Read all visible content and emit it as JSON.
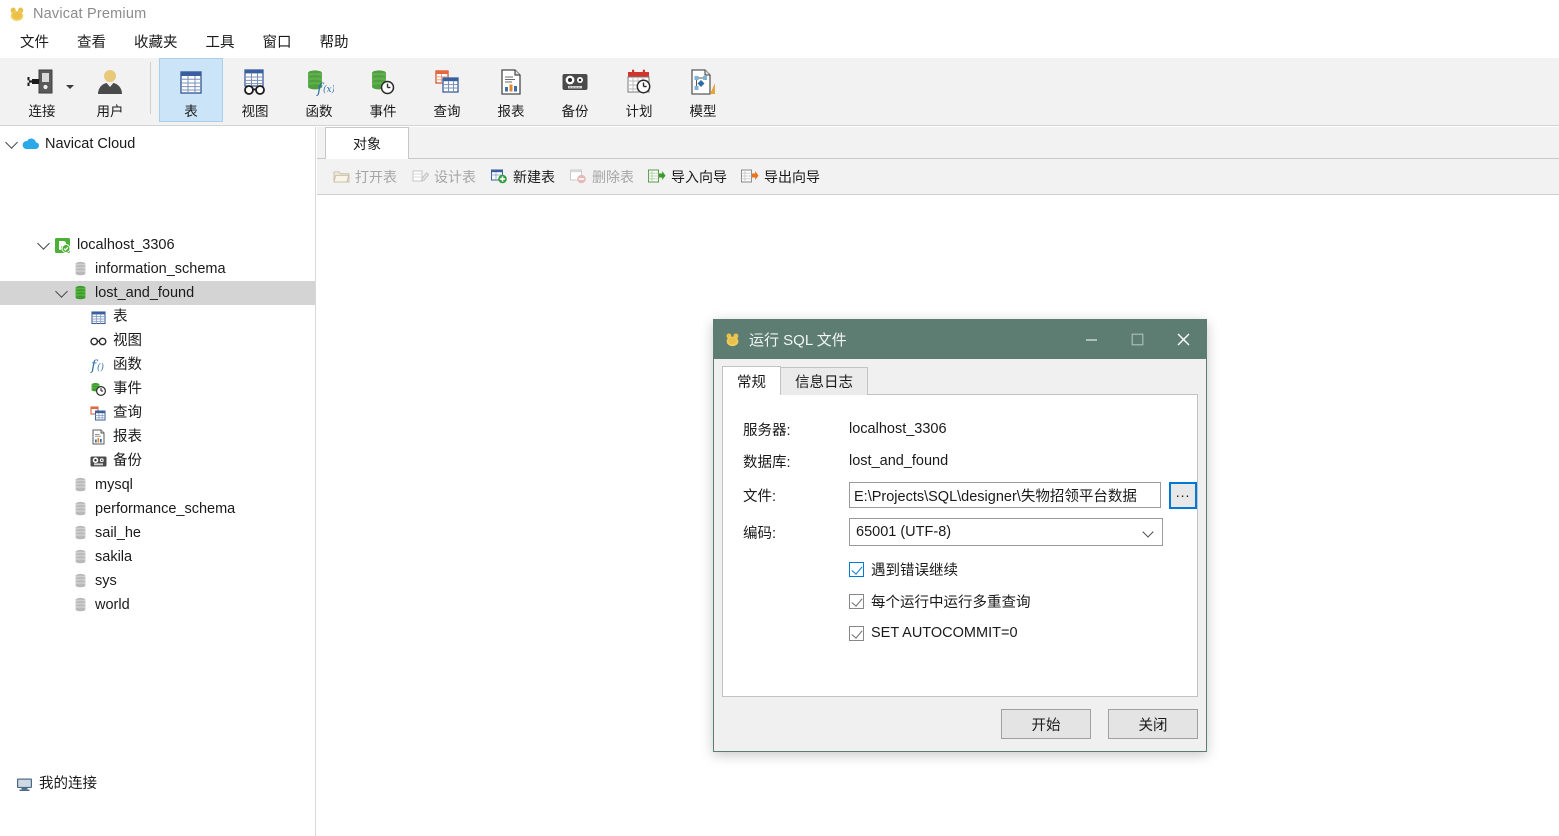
{
  "window": {
    "title": "Navicat Premium",
    "logo_icon": "navicat-logo-icon"
  },
  "menubar": {
    "items": [
      {
        "label": "文件",
        "name": "menu-file"
      },
      {
        "label": "查看",
        "name": "menu-view"
      },
      {
        "label": "收藏夹",
        "name": "menu-favorites"
      },
      {
        "label": "工具",
        "name": "menu-tools"
      },
      {
        "label": "窗口",
        "name": "menu-window"
      },
      {
        "label": "帮助",
        "name": "menu-help"
      }
    ]
  },
  "toolbar": {
    "buttons": [
      {
        "label": "连接",
        "icon": "connection-icon",
        "selected": false,
        "has_caret": true
      },
      {
        "label": "用户",
        "icon": "user-icon",
        "selected": false,
        "has_caret": false
      },
      {
        "label": "表",
        "icon": "table-icon",
        "selected": true,
        "has_caret": false
      },
      {
        "label": "视图",
        "icon": "view-icon",
        "selected": false,
        "has_caret": false
      },
      {
        "label": "函数",
        "icon": "function-icon",
        "selected": false,
        "has_caret": false
      },
      {
        "label": "事件",
        "icon": "event-icon",
        "selected": false,
        "has_caret": false
      },
      {
        "label": "查询",
        "icon": "query-icon",
        "selected": false,
        "has_caret": false
      },
      {
        "label": "报表",
        "icon": "report-icon",
        "selected": false,
        "has_caret": false
      },
      {
        "label": "备份",
        "icon": "backup-icon",
        "selected": false,
        "has_caret": false
      },
      {
        "label": "计划",
        "icon": "schedule-icon",
        "selected": false,
        "has_caret": false
      },
      {
        "label": "模型",
        "icon": "model-icon",
        "selected": false,
        "has_caret": false
      }
    ]
  },
  "sidebar": {
    "cloud": {
      "label": "Navicat Cloud",
      "icon": "cloud-icon"
    },
    "connection": {
      "label": "localhost_3306",
      "icon": "mysql-connection-icon"
    },
    "databases": [
      {
        "label": "information_schema",
        "icon": "database-icon-gray",
        "selected": false,
        "expanded": false
      },
      {
        "label": "lost_and_found",
        "icon": "database-icon-green",
        "selected": true,
        "expanded": true
      },
      {
        "label": "mysql",
        "icon": "database-icon-gray",
        "selected": false,
        "expanded": false
      },
      {
        "label": "performance_schema",
        "icon": "database-icon-gray",
        "selected": false,
        "expanded": false
      },
      {
        "label": "sail_he",
        "icon": "database-icon-gray",
        "selected": false,
        "expanded": false
      },
      {
        "label": "sakila",
        "icon": "database-icon-gray",
        "selected": false,
        "expanded": false
      },
      {
        "label": "sys",
        "icon": "database-icon-gray",
        "selected": false,
        "expanded": false
      },
      {
        "label": "world",
        "icon": "database-icon-gray",
        "selected": false,
        "expanded": false
      }
    ],
    "db_children": [
      {
        "label": "表",
        "icon": "table-icon"
      },
      {
        "label": "视图",
        "icon": "view-icon"
      },
      {
        "label": "函数",
        "icon": "function-icon"
      },
      {
        "label": "事件",
        "icon": "event-icon"
      },
      {
        "label": "查询",
        "icon": "query-icon"
      },
      {
        "label": "报表",
        "icon": "report-icon"
      },
      {
        "label": "备份",
        "icon": "backup-icon"
      }
    ],
    "my_connections": {
      "label": "我的连接",
      "icon": "monitor-icon"
    }
  },
  "objects_panel": {
    "tab_label": "对象",
    "actions": [
      {
        "label": "打开表",
        "icon": "open-table-icon",
        "disabled": true
      },
      {
        "label": "设计表",
        "icon": "design-table-icon",
        "disabled": true
      },
      {
        "label": "新建表",
        "icon": "new-table-icon",
        "disabled": false
      },
      {
        "label": "删除表",
        "icon": "delete-table-icon",
        "disabled": true
      },
      {
        "label": "导入向导",
        "icon": "import-wizard-icon",
        "disabled": false
      },
      {
        "label": "导出向导",
        "icon": "export-wizard-icon",
        "disabled": false
      }
    ]
  },
  "dialog": {
    "title": "运行 SQL 文件",
    "logo_icon": "navicat-logo-icon",
    "window_buttons": {
      "minimize": "—",
      "maximize": "□",
      "close": "✕"
    },
    "tabs": [
      {
        "label": "常规",
        "active": true
      },
      {
        "label": "信息日志",
        "active": false
      }
    ],
    "fields": [
      {
        "label": "服务器:",
        "value": "localhost_3306",
        "type": "static"
      },
      {
        "label": "数据库:",
        "value": "lost_and_found",
        "type": "static"
      }
    ],
    "file_field": {
      "label": "文件:",
      "value": "E:\\Projects\\SQL\\designer\\失物招领平台数据",
      "browse_label": "..."
    },
    "encoding_field": {
      "label": "编码:",
      "value": "65001 (UTF-8)"
    },
    "checkboxes": [
      {
        "label": "遇到错误继续",
        "checked": true,
        "focused": true
      },
      {
        "label": "每个运行中运行多重查询",
        "checked": true,
        "focused": false
      },
      {
        "label": "SET AUTOCOMMIT=0",
        "checked": true,
        "focused": false
      }
    ],
    "buttons": [
      {
        "label": "开始",
        "name": "start-button"
      },
      {
        "label": "关闭",
        "name": "close-button"
      }
    ]
  },
  "colors": {
    "dialog_title_bar": "#5d7c72",
    "toolbar_bg": "#f2f2f2",
    "selected_tool": "#cce4f7",
    "tree_selected": "#d4d4d4",
    "accent_blue": "#0078d7"
  }
}
